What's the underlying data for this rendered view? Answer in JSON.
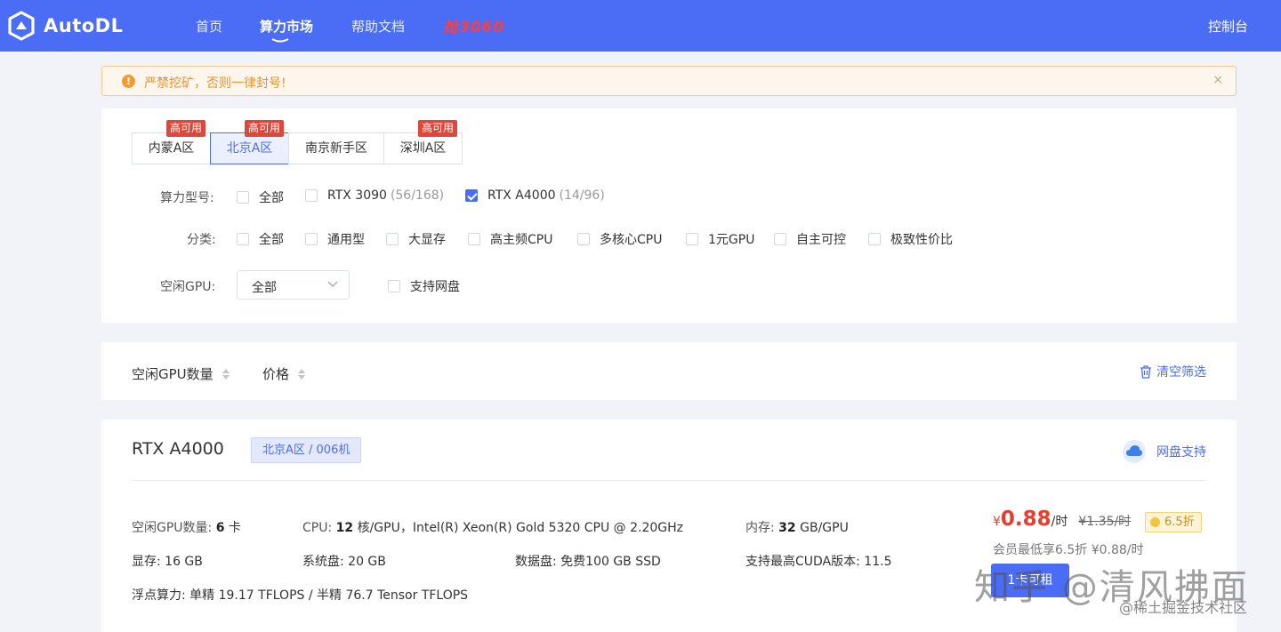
{
  "header": {
    "logo_text": "AutoDL",
    "nav": [
      "首页",
      "算力市场",
      "帮助文档"
    ],
    "promo": "抢3060",
    "console": "控制台"
  },
  "alert": {
    "text": "严禁挖矿，否则一律封号!",
    "close": "×"
  },
  "regions": [
    {
      "label": "内蒙A区",
      "badge": "高可用",
      "active": false
    },
    {
      "label": "北京A区",
      "badge": "高可用",
      "active": true
    },
    {
      "label": "南京新手区",
      "badge": "",
      "active": false
    },
    {
      "label": "深圳A区",
      "badge": "高可用",
      "active": false
    }
  ],
  "filters": {
    "gpu_model_label": "算力型号:",
    "gpu_models": [
      {
        "label": "全部",
        "count": "",
        "checked": false
      },
      {
        "label": "RTX 3090",
        "count": "(56/168)",
        "checked": false
      },
      {
        "label": "RTX A4000",
        "count": "(14/96)",
        "checked": true
      }
    ],
    "category_label": "分类:",
    "categories": [
      "全部",
      "通用型",
      "大显存",
      "高主频CPU",
      "多核心CPU",
      "1元GPU",
      "自主可控",
      "极致性价比"
    ],
    "idle_gpu_label": "空闲GPU:",
    "idle_gpu_value": "全部",
    "net_disk_label": "支持网盘"
  },
  "sort": {
    "idle_gpu_count": "空闲GPU数量",
    "price": "价格",
    "clear": "清空筛选"
  },
  "machine": {
    "gpu_name": "RTX A4000",
    "location": "北京A区 / 006机",
    "net_disk": "网盘支持",
    "idle_gpu_key": "空闲GPU数量:",
    "idle_gpu_val": "6",
    "idle_gpu_unit": "卡",
    "cpu_key": "CPU:",
    "cpu_cores": "12",
    "cpu_rest": "核/GPU，Intel(R) Xeon(R) Gold 5320 CPU @ 2.20GHz",
    "mem_key": "内存:",
    "mem_val": "32",
    "mem_unit": "GB/GPU",
    "vram": "显存:  16 GB",
    "sys_disk": "系统盘:  20 GB",
    "data_disk": "数据盘:  免费100 GB SSD",
    "cuda": "支持最高CUDA版本:  11.5",
    "flops": "浮点算力:  单精 19.17 TFLOPS / 半精 76.7 Tensor TFLOPS",
    "price_symbol": "¥",
    "price_now": "0.88",
    "price_unit": "/时",
    "price_old": "¥1.35/时",
    "discount": "6.5折",
    "member": "会员最低享6.5折 ¥0.88/时",
    "rent_button": "1卡可租"
  },
  "watermark": {
    "main": "知乎 @清风拂面",
    "sub": "@稀土掘金技术社区"
  },
  "colors": {
    "brand": "#4b6cf5",
    "price": "#e53e2f",
    "badge": "#e0473b",
    "alert_text": "#e6922f"
  }
}
